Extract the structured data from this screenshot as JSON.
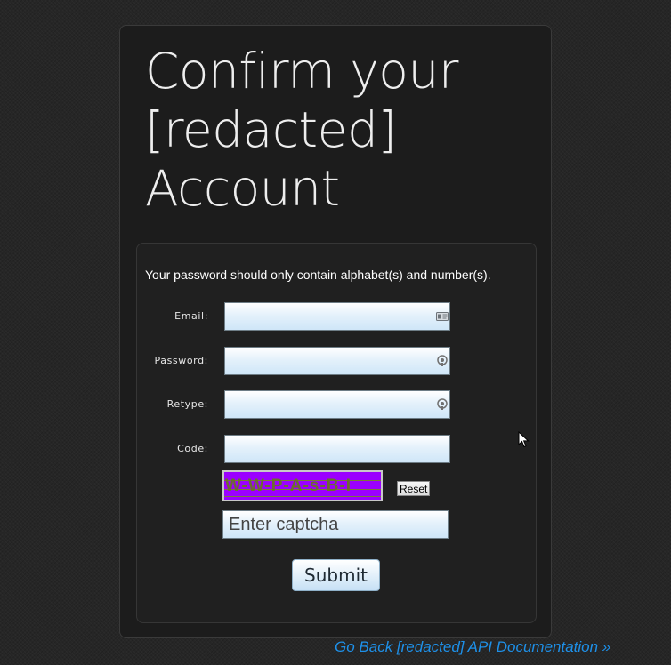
{
  "page": {
    "title": "Confirm your [redacted] Account",
    "hint": "Your password should only contain alphabet(s) and number(s)."
  },
  "form": {
    "email": {
      "label": "Email:",
      "value": "",
      "icon": "contact-card-icon"
    },
    "password": {
      "label": "Password:",
      "value": "",
      "icon": "lock-icon"
    },
    "retype": {
      "label": "Retype:",
      "value": "",
      "icon": "lock-icon"
    },
    "code": {
      "label": "Code:",
      "value": ""
    },
    "captcha": {
      "image_text": "W-W-P-A-s-B-I",
      "image_bg": "#9b00ff",
      "reset_label": "Reset",
      "placeholder": "Enter captcha"
    },
    "submit_label": "Submit"
  },
  "footer": {
    "back_link": "Go Back [redacted] API Documentation »"
  },
  "colors": {
    "background": "#262626",
    "card": "#1c1c1c",
    "link": "#1e90e8",
    "captcha_bg": "#9b00ff"
  }
}
